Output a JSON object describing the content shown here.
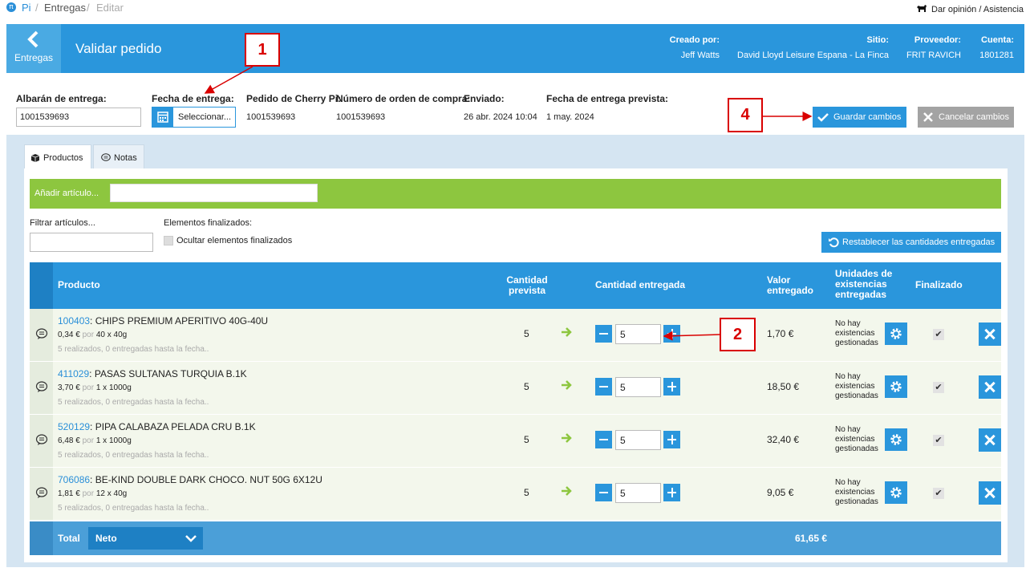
{
  "breadcrumb": {
    "app": "Pi",
    "section": "Entregas",
    "current": "Editar",
    "sep": "/"
  },
  "topbar": {
    "feedback": "Dar opinión / Asistencia"
  },
  "header": {
    "back_label": "Entregas",
    "title": "Validar pedido",
    "created_by_label": "Creado por:",
    "created_by": "Jeff Watts",
    "site_label": "Sitio:",
    "site": "David Lloyd Leisure Espana - La Finca",
    "supplier_label": "Proveedor:",
    "supplier": "FRIT RAVICH",
    "account_label": "Cuenta:",
    "account": "1801281"
  },
  "form": {
    "delivery_note_label": "Albarán de entrega:",
    "delivery_note": "1001539693",
    "delivery_date_label": "Fecha de entrega:",
    "delivery_date_button": "Seleccionar...",
    "cherry_order_label": "Pedido de Cherry Pi:",
    "cherry_order": "1001539693",
    "po_label": "Número de orden de compra:",
    "po": "1001539693",
    "sent_label": "Enviado:",
    "sent": "26 abr. 2024 10:04",
    "expected_label": "Fecha de entrega prevista:",
    "expected": "1 may. 2024",
    "save_button": "Guardar cambios",
    "cancel_button": "Cancelar cambios"
  },
  "callouts": {
    "c1": "1",
    "c2": "2",
    "c4": "4"
  },
  "tabs": [
    {
      "label": "Productos",
      "icon": "box-icon",
      "active": true
    },
    {
      "label": "Notas",
      "icon": "comment-icon",
      "active": false
    }
  ],
  "add_item": {
    "label": "Añadir artículo..."
  },
  "filter": {
    "label": "Filtrar artículos...",
    "finished_label": "Elementos finalizados:",
    "hide_finished": "Ocultar elementos finalizados",
    "reset_button": "Restablecer las cantidades entregadas"
  },
  "table": {
    "headers": {
      "product": "Producto",
      "expected": "Cantidad prevista",
      "delivered": "Cantidad entregada",
      "value": "Valor entregado",
      "stock_units": "Unidades de existencias entregadas",
      "finished": "Finalizado"
    },
    "rows": [
      {
        "code": "100403",
        "name": ": CHIPS PREMIUM APERITIVO 40G-40U",
        "price": "0,34 €",
        "por": "por",
        "pack": "40 x 40g",
        "done": "5 realizados, 0 entregadas hasta la fecha..",
        "expected": "5",
        "qty": "5",
        "value": "1,70 €",
        "stock": "No hay existencias gestionadas",
        "finished": "✔"
      },
      {
        "code": "411029",
        "name": ": PASAS SULTANAS TURQUIA B.1K",
        "price": "3,70 €",
        "por": "por",
        "pack": "1 x 1000g",
        "done": "5 realizados, 0 entregadas hasta la fecha..",
        "expected": "5",
        "qty": "5",
        "value": "18,50 €",
        "stock": "No hay existencias gestionadas",
        "finished": "✔"
      },
      {
        "code": "520129",
        "name": ": PIPA CALABAZA PELADA CRU B.1K",
        "price": "6,48 €",
        "por": "por",
        "pack": "1 x 1000g",
        "done": "5 realizados, 0 entregadas hasta la fecha..",
        "expected": "5",
        "qty": "5",
        "value": "32,40 €",
        "stock": "No hay existencias gestionadas",
        "finished": "✔"
      },
      {
        "code": "706086",
        "name": ": BE-KIND DOUBLE DARK CHOCO. NUT 50G 6X12U",
        "price": "1,81 €",
        "por": "por",
        "pack": "12 x 40g",
        "done": "5 realizados, 0 entregadas hasta la fecha..",
        "expected": "5",
        "qty": "5",
        "value": "9,05 €",
        "stock": "No hay existencias gestionadas",
        "finished": "✔"
      }
    ],
    "footer": {
      "label": "Total",
      "select": "Neto",
      "total": "61,65 €"
    }
  },
  "colors": {
    "primary": "#2a96dc",
    "green": "#8dc63f",
    "callout": "#d90000"
  }
}
